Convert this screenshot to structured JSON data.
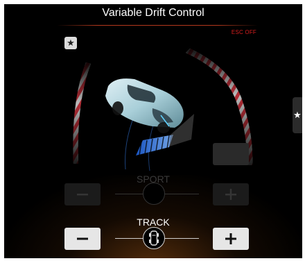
{
  "header": {
    "title": "Variable Drift Control",
    "status": "ESC OFF"
  },
  "favorite_button": {
    "icon": "star-icon",
    "glyph": "★"
  },
  "side_tab": {
    "icon": "star-icon",
    "glyph": "★"
  },
  "modes": [
    {
      "label": "SPORT",
      "active": false
    },
    {
      "label": "TRACK",
      "active": true
    }
  ],
  "colors": {
    "background": "#000000",
    "status_red": "#d81e1e",
    "accent_blue": "#3a8cff",
    "track_curb_red": "#c8323c",
    "button_active": "#e6e6e6",
    "button_inactive": "#1b1b1b"
  },
  "icons": {
    "minus": "minus-icon",
    "plus": "plus-icon",
    "knob_active": "car-top-icon"
  }
}
